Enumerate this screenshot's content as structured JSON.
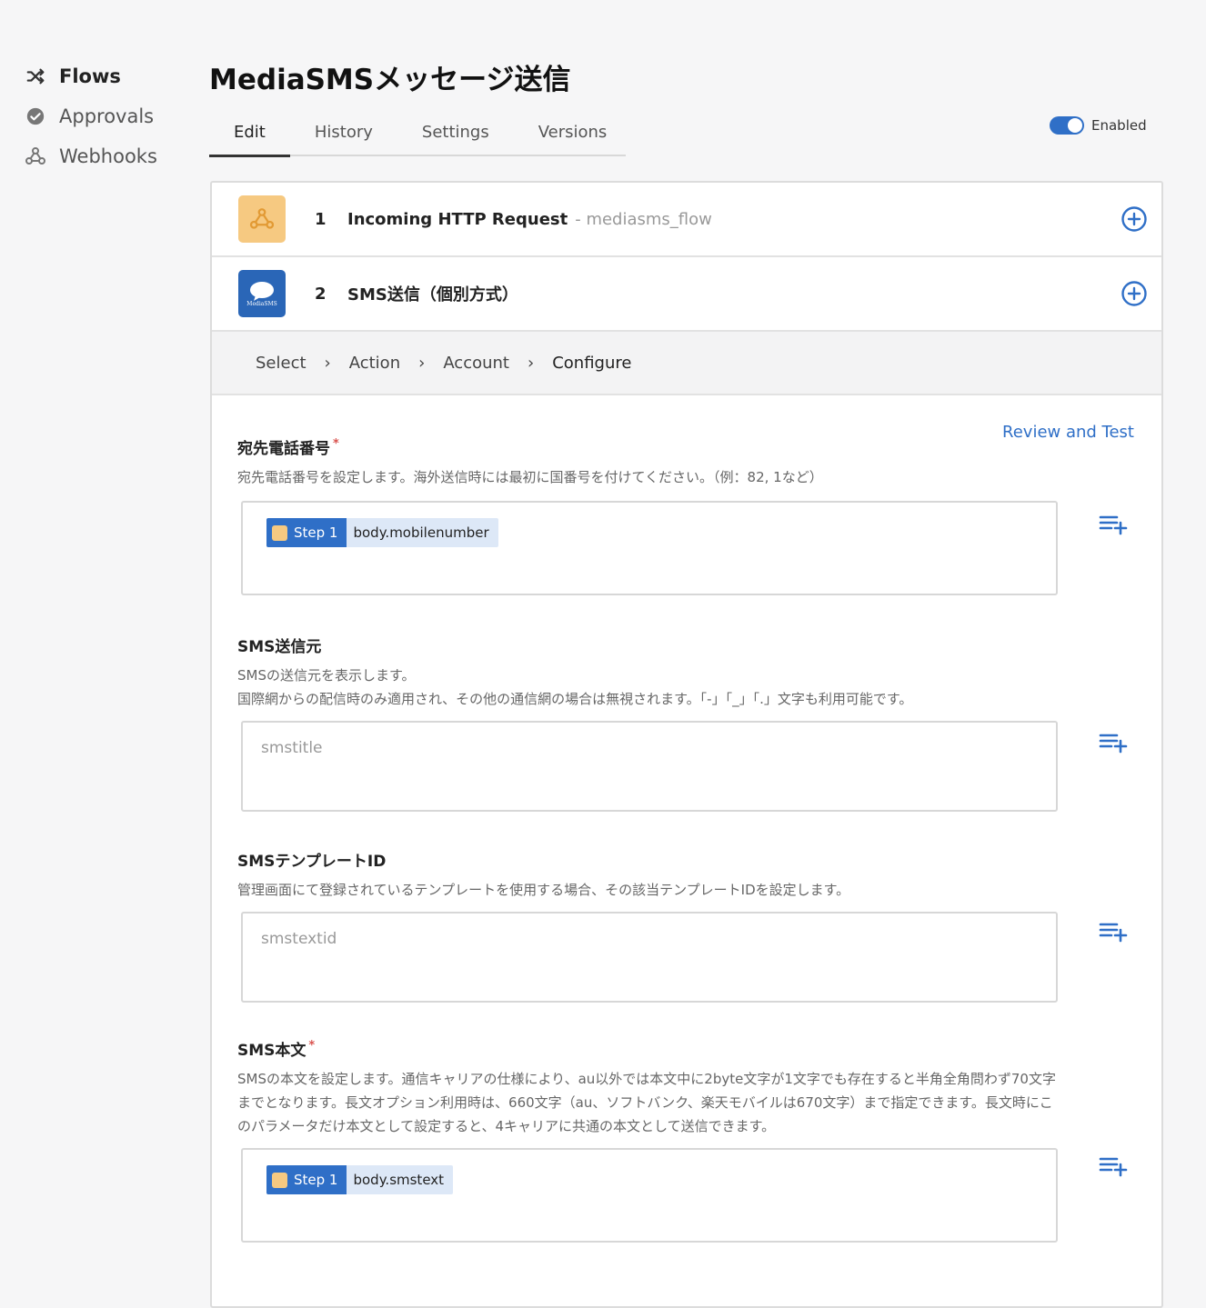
{
  "sidebar": {
    "items": [
      {
        "label": "Flows",
        "icon": "shuffle-icon"
      },
      {
        "label": "Approvals",
        "icon": "check-circle-icon"
      },
      {
        "label": "Webhooks",
        "icon": "webhook-icon"
      }
    ]
  },
  "header": {
    "title": "MediaSMSメッセージ送信",
    "tabs": [
      {
        "label": "Edit"
      },
      {
        "label": "History"
      },
      {
        "label": "Settings"
      },
      {
        "label": "Versions"
      }
    ],
    "active_tab": "Edit",
    "toggle": {
      "label": "Enabled",
      "on": true
    }
  },
  "steps": [
    {
      "number": "1",
      "title": "Incoming HTTP Request",
      "subtitle": "- mediasms_flow",
      "icon": "webhook-icon"
    },
    {
      "number": "2",
      "title": "SMS送信（個別方式）",
      "icon": "mediasms-icon",
      "icon_text": "MediaSMS"
    }
  ],
  "breadcrumb": {
    "items": [
      "Select",
      "Action",
      "Account",
      "Configure"
    ],
    "current": "Configure"
  },
  "review_link": "Review and Test",
  "fields": [
    {
      "label": "宛先電話番号",
      "required": true,
      "desc": [
        "宛先電話番号を設定します。海外送信時には最初に国番号を付けてください。（例：82, 1など）"
      ],
      "pill": {
        "step": "Step 1",
        "path": "body.mobilenumber"
      }
    },
    {
      "label": "SMS送信元",
      "required": false,
      "desc": [
        "SMSの送信元を表示します。",
        "国際網からの配信時のみ適用され、その他の通信網の場合は無視されます。「-」「_」「.」文字も利用可能です。"
      ],
      "placeholder": "smstitle"
    },
    {
      "label": "SMSテンプレートID",
      "required": false,
      "desc": [
        "管理画面にて登録されているテンプレートを使用する場合、その該当テンプレートIDを設定します。"
      ],
      "placeholder": "smstextid"
    },
    {
      "label": "SMS本文",
      "required": true,
      "desc": [
        "SMSの本文を設定します。通信キャリアの仕様により、au以外では本文中に2byte文字が1文字でも存在すると半角全角問わず70文字",
        "までとなります。長文オプション利用時は、660文字（au、ソフトバンク、楽天モバイルは670文字）まで指定できます。長文時にこ",
        "のパラメータだけ本文として設定すると、4キャリアに共通の本文として送信できます。"
      ],
      "pill": {
        "step": "Step 1",
        "path": "body.smstext"
      }
    }
  ],
  "colors": {
    "accent": "#2f6fc7",
    "webhook_bg": "#f6c981",
    "sms_bg": "#2a66b7",
    "required": "#d9534f"
  }
}
